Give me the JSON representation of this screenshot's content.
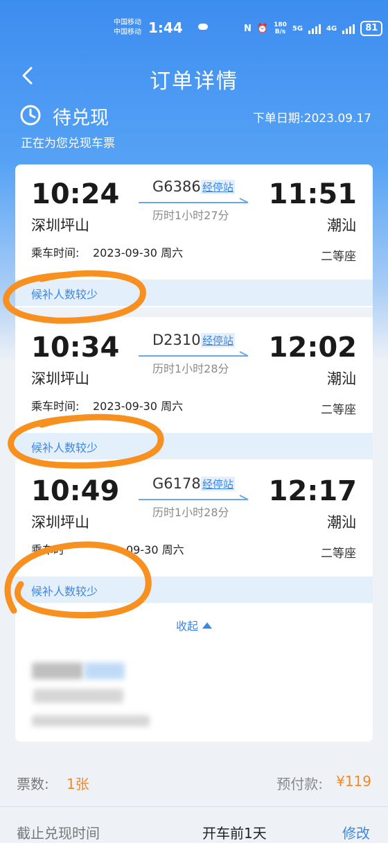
{
  "status_bar": {
    "carrier_1": "中国移动",
    "carrier_2": "中国移动",
    "time": "1:44",
    "net_speed_value": "180",
    "net_speed_unit": "B/s",
    "network": "5G",
    "network2": "4G",
    "battery": "81"
  },
  "nav": {
    "title": "订单详情",
    "back_icon": "back-arrow-icon"
  },
  "order_status": {
    "title": "待兑现",
    "subtitle": "正在为您兑现车票",
    "order_date": "下单日期:2023.09.17",
    "icon": "clock-icon"
  },
  "trains": [
    {
      "depart_time": "10:24",
      "depart_station": "深圳坪山",
      "train_no": "G6386",
      "stops_link": "经停站",
      "duration": "历时1小时27分",
      "arrive_time": "11:51",
      "arrive_station": "潮汕",
      "ride_label": "乘车时间:",
      "ride_date": "2023-09-30 周六",
      "seat": "二等座",
      "hint": "候补人数较少"
    },
    {
      "depart_time": "10:34",
      "depart_station": "深圳坪山",
      "train_no": "D2310",
      "stops_link": "经停站",
      "duration": "历时1小时28分",
      "arrive_time": "12:02",
      "arrive_station": "潮汕",
      "ride_label": "乘车时间:",
      "ride_date": "2023-09-30 周六",
      "seat": "二等座",
      "hint": "候补人数较少"
    },
    {
      "depart_time": "10:49",
      "depart_station": "深圳坪山",
      "train_no": "G6178",
      "stops_link": "经停站",
      "duration": "历时1小时28分",
      "arrive_time": "12:17",
      "arrive_station": "潮汕",
      "ride_label": "乘车时",
      "ride_date": "09-30 周六",
      "seat": "二等座",
      "hint": "候补人数较少"
    }
  ],
  "collapse_label": "收起",
  "summary": {
    "ticket_label": "票数:",
    "ticket_value": "1张",
    "prepay_label": "预付款:",
    "prepay_value": "¥119"
  },
  "deadline": {
    "label": "截止兑现时间",
    "value": "开车前1天",
    "modify": "修改"
  },
  "colors": {
    "header_blue": "#3d8df0",
    "link_blue": "#3b86e6",
    "accent_orange": "#f08a24",
    "marker_orange": "#f7901e"
  }
}
